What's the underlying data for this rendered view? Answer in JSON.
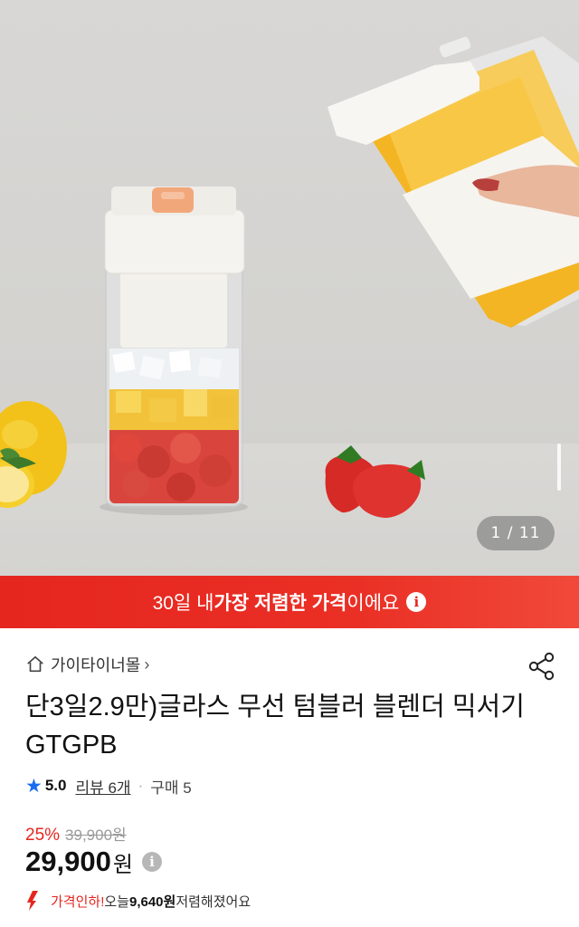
{
  "gallery": {
    "counter": "1 / 11"
  },
  "banner": {
    "text_pre": "30일 내 ",
    "text_bold": "가장 저렴한 가격",
    "text_post": "이에요",
    "info_icon": "info-icon"
  },
  "store": {
    "name": "가이타이너몰",
    "chevron": "›"
  },
  "product": {
    "title": "단3일2.9만)글라스 무선 텀블러 블렌더 믹서기 GTGPB"
  },
  "rating": {
    "score": "5.0",
    "review_label": "리뷰 6개",
    "separator": "·",
    "purchase_label": "구매 5"
  },
  "price": {
    "discount": "25%",
    "original": "39,900원",
    "current": "29,900",
    "currency": "원",
    "drop_label": "가격인하!",
    "drop_text_pre": " 오늘 ",
    "drop_amount": "9,640원",
    "drop_text_post": " 저렴해졌어요"
  },
  "colors": {
    "accent_red": "#e5261f",
    "star_blue": "#1a6df0"
  }
}
